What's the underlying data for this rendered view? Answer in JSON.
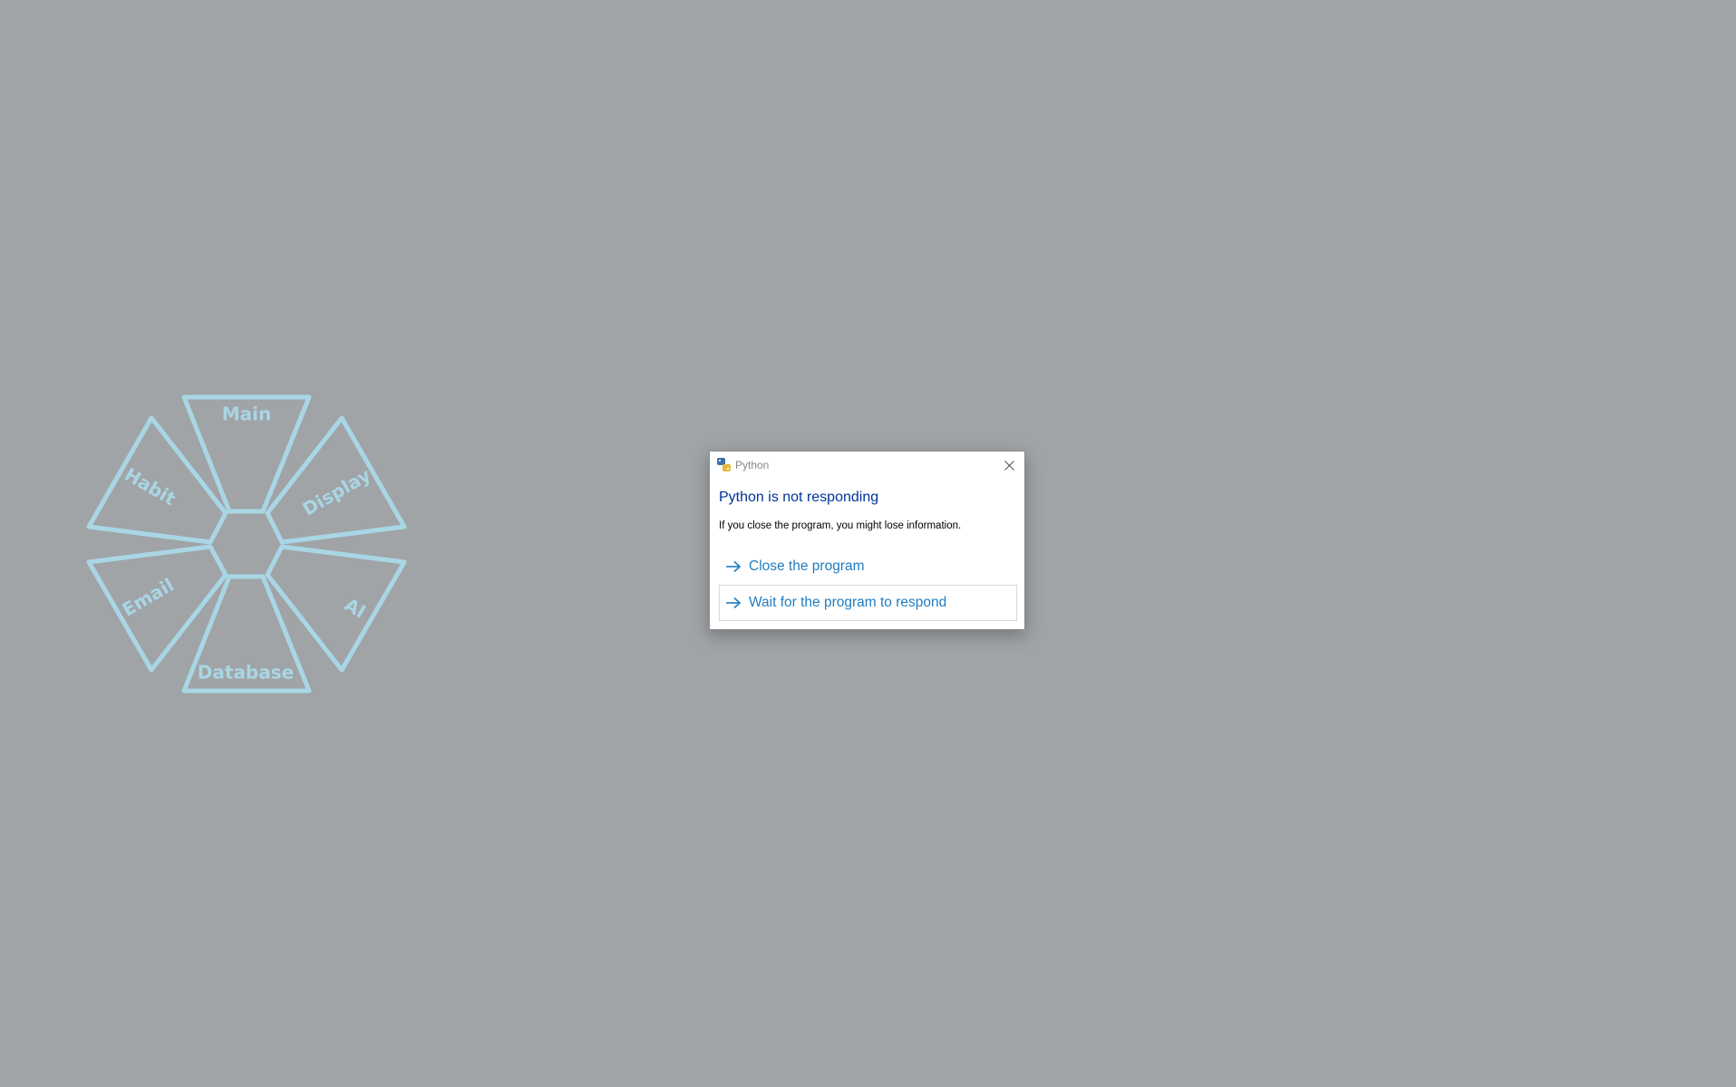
{
  "radial_menu": {
    "segments": [
      {
        "label": "Main"
      },
      {
        "label": "Display"
      },
      {
        "label": "AI"
      },
      {
        "label": "Database"
      },
      {
        "label": "Email"
      },
      {
        "label": "Habit"
      }
    ],
    "accent_color": "#a9d6e5"
  },
  "dialog": {
    "title": "Python",
    "app_icon": "python-icon",
    "main_instruction": "Python is not responding",
    "content": "If you close the program, you might lose information.",
    "commands": [
      {
        "label": "Close the program",
        "icon": "arrow-right-icon"
      },
      {
        "label": "Wait for the program to respond",
        "icon": "arrow-right-icon"
      }
    ],
    "close_icon": "close-icon",
    "colors": {
      "instruction": "#003399",
      "link": "#1f7cc2",
      "background": "#a0a4a7"
    }
  }
}
